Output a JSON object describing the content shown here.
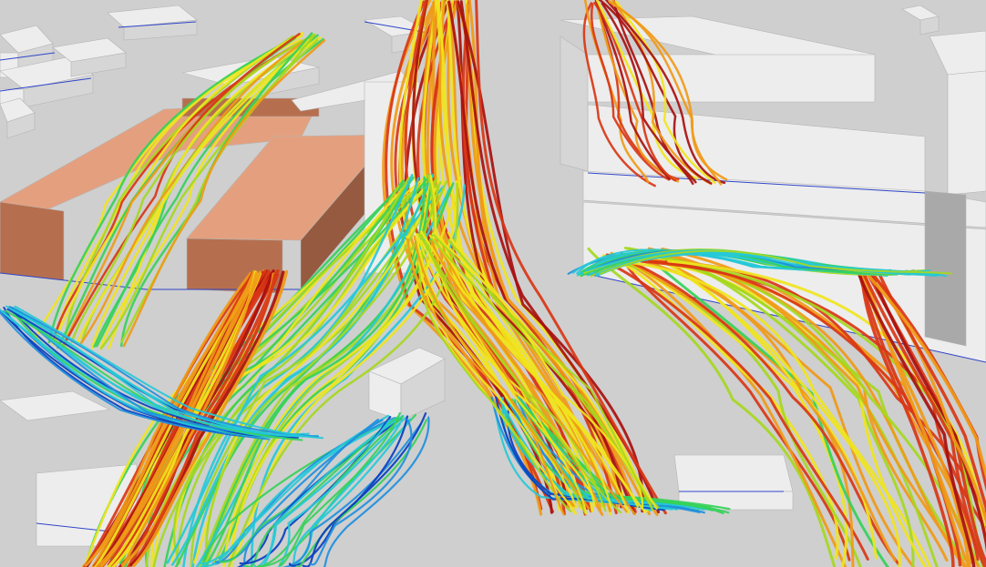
{
  "scene": {
    "ground_color": "#cfcfcf",
    "building_light": "#ededed",
    "building_mid": "#d6d6d6",
    "building_dark": "#a9a9a9",
    "highlight_building_top": "#e4a07e",
    "highlight_building_front": "#b66f4e",
    "highlight_building_side": "#955a40",
    "outline_color": "#2f45c9",
    "velocity_colormap": [
      "#0a3fbf",
      "#1f8fe0",
      "#25c9d8",
      "#36d15a",
      "#a6d81f",
      "#f0e51d",
      "#f09a17",
      "#d93615",
      "#a8100f"
    ]
  }
}
